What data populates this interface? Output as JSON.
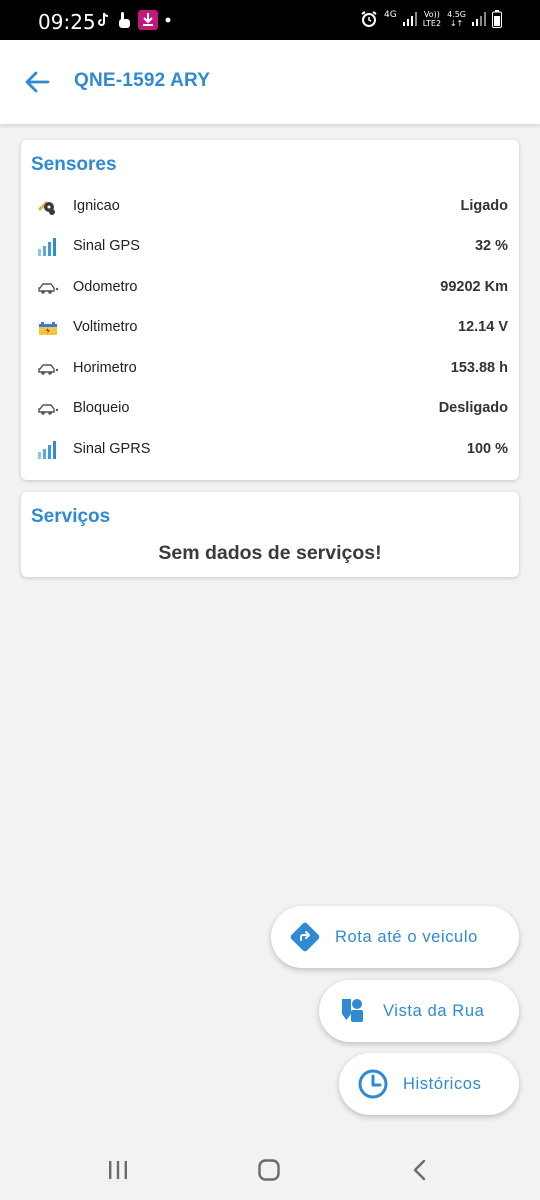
{
  "status_bar": {
    "time": "09:25",
    "network_left": "4G",
    "volte_top": "Vo))",
    "volte_bottom": "LTE2",
    "network_right": "4.5G"
  },
  "app_bar": {
    "title": "QNE-1592 ARY"
  },
  "sensors": {
    "title": "Sensores",
    "items": [
      {
        "label": "Ignicao",
        "value": "Ligado",
        "icon": "ignition-key-icon"
      },
      {
        "label": "Sinal GPS",
        "value": "32 %",
        "icon": "signal-bars-icon"
      },
      {
        "label": "Odometro",
        "value": "99202 Km",
        "icon": "car-odometer-icon"
      },
      {
        "label": "Voltimetro",
        "value": "12.14 V",
        "icon": "battery-icon"
      },
      {
        "label": "Horimetro",
        "value": "153.88 h",
        "icon": "car-hour-meter-icon"
      },
      {
        "label": "Bloqueio",
        "value": "Desligado",
        "icon": "car-lock-icon"
      },
      {
        "label": "Sinal GPRS",
        "value": "100 %",
        "icon": "signal-bars-icon"
      }
    ]
  },
  "services": {
    "title": "Serviços",
    "empty_message": "Sem dados de serviços!"
  },
  "fabs": {
    "route_label": "Rota até o veiculo",
    "street_view_label": "Vista da Rua",
    "history_label": "Históricos"
  },
  "colors": {
    "accent": "#2f8ad3",
    "background": "#f2f2f2"
  }
}
